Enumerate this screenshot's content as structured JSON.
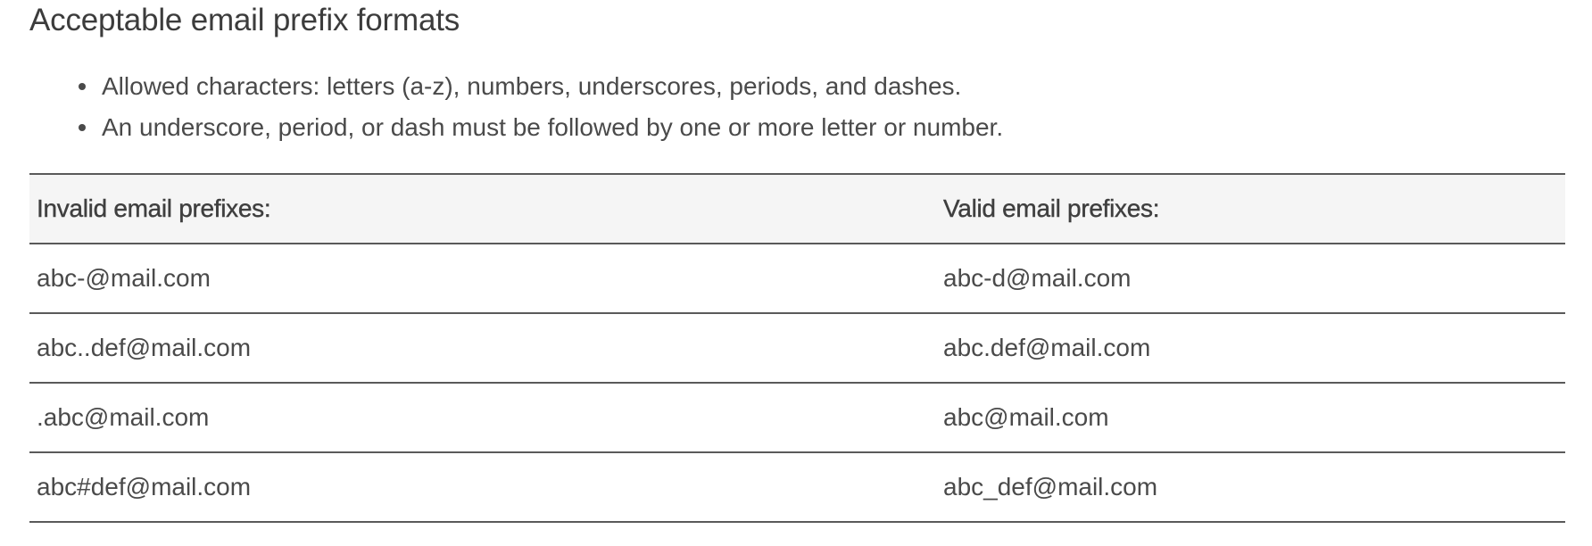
{
  "heading": "Acceptable email prefix formats",
  "rules": [
    "Allowed characters: letters (a-z), numbers, underscores, periods, and dashes.",
    "An underscore, period, or dash must be followed by one or more letter or number."
  ],
  "table": {
    "headers": {
      "invalid": "Invalid email prefixes:",
      "valid": "Valid email prefixes:"
    },
    "rows": [
      {
        "invalid": "abc-@mail.com",
        "valid": "abc-d@mail.com"
      },
      {
        "invalid": "abc..def@mail.com",
        "valid": "abc.def@mail.com"
      },
      {
        "invalid": ".abc@mail.com",
        "valid": "abc@mail.com"
      },
      {
        "invalid": "abc#def@mail.com",
        "valid": "abc_def@mail.com"
      }
    ]
  }
}
